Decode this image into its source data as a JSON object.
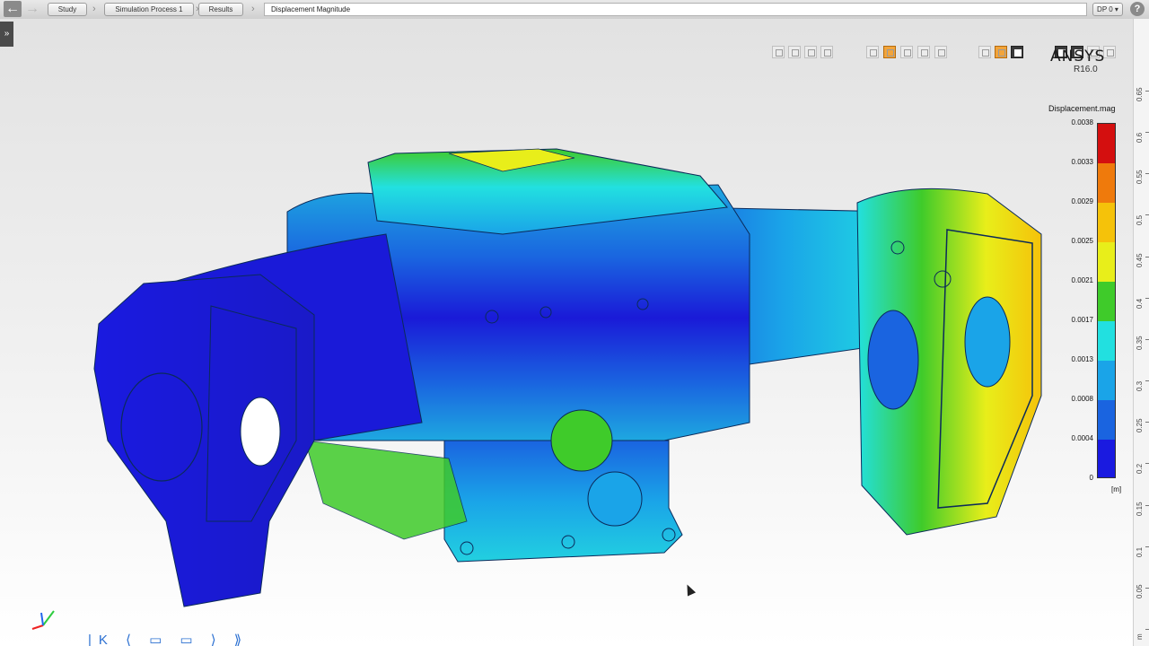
{
  "nav": {
    "back_icon": "arrow-left-icon",
    "forward_icon": "arrow-right-icon"
  },
  "breadcrumb": {
    "items": [
      {
        "label": "Study"
      },
      {
        "label": "Simulation Process 1"
      },
      {
        "label": "Results"
      }
    ],
    "current": "Displacement Magnitude"
  },
  "design_point": {
    "label": "DP 0 ▾"
  },
  "help": {
    "label": "?"
  },
  "side_tabs": {
    "left": "»",
    "right": "«"
  },
  "brand": {
    "name": "ANSYS",
    "version": "R16.0"
  },
  "legend": {
    "title": "Displacement.mag",
    "unit": "[m]",
    "labels": [
      "0.0038",
      "0.0033",
      "0.0029",
      "0.0025",
      "0.0021",
      "0.0017",
      "0.0013",
      "0.0008",
      "0.0004",
      "0"
    ],
    "colors": [
      "#d40f0f",
      "#ef7a0c",
      "#f5c20a",
      "#e8ee1a",
      "#3fcb2a",
      "#22e0e0",
      "#1aa4e8",
      "#1a64e0",
      "#1a1ae0"
    ]
  },
  "ruler": {
    "ticks": [
      "0.65",
      "0.6",
      "0.55",
      "0.5",
      "0.45",
      "0.4",
      "0.35",
      "0.3",
      "0.25",
      "0.2",
      "0.15",
      "0.1",
      "0.05",
      "m"
    ]
  },
  "bottom_tools": {
    "glyphs": "|K ⟨ ▭ ▭ ⟩ ⟫"
  }
}
